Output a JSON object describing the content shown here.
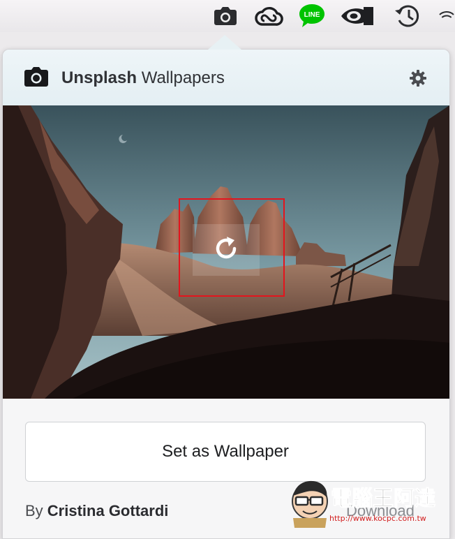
{
  "app": {
    "title_bold": "Unsplash",
    "title_rest": " Wallpapers"
  },
  "menubar": {
    "icons": [
      "camera-icon",
      "creative-cloud-icon",
      "line-icon",
      "nvidia-icon",
      "time-machine-icon",
      "wifi-icon"
    ],
    "line_label": "LINE"
  },
  "main": {
    "set_wallpaper_label": "Set as Wallpaper",
    "author_prefix": "By ",
    "author_name": "Cristina Gottardi",
    "download_label": "Download"
  },
  "watermark": {
    "brand": "電腦王阿達",
    "url": "http://www.kocpc.com.tw"
  },
  "colors": {
    "line_green": "#00c300",
    "highlight_red": "#e4141d",
    "sky_top": "#39525b",
    "sky_bottom": "#8fb0b9"
  }
}
